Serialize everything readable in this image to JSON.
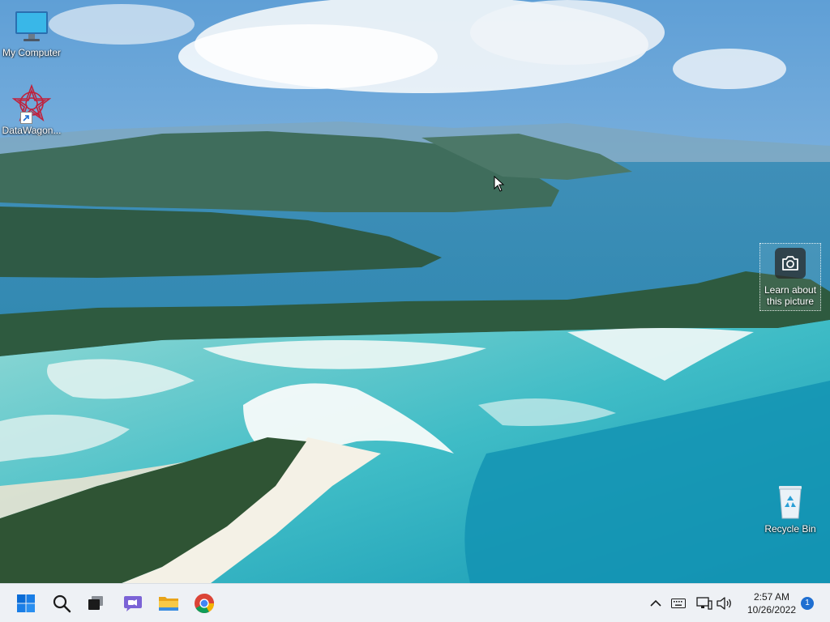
{
  "desktop": {
    "icons": [
      {
        "label": "My Computer"
      },
      {
        "label": "DataWagon..."
      },
      {
        "label": "Recycle Bin"
      }
    ],
    "spotlight": {
      "label": "Learn about this picture",
      "icon": "camera-icon"
    }
  },
  "taskbar": {
    "start_icon": "windows-start-icon",
    "search_icon": "search-icon",
    "taskview_icon": "task-view-icon",
    "chat_icon": "chat-icon",
    "explorer_icon": "file-explorer-icon",
    "chrome_icon": "chrome-icon",
    "tray": {
      "overflow_icon": "chevron-up-icon",
      "keyboard_icon": "keyboard-icon",
      "network_icon": "network-icon",
      "volume_icon": "volume-icon",
      "time": "2:57 AM",
      "date": "10/26/2022",
      "notification_count": "1"
    }
  },
  "colors": {
    "taskbar_bg": "#eef1f5",
    "start_blue": "#0a6cd6",
    "accent": "#1f6fd1"
  }
}
